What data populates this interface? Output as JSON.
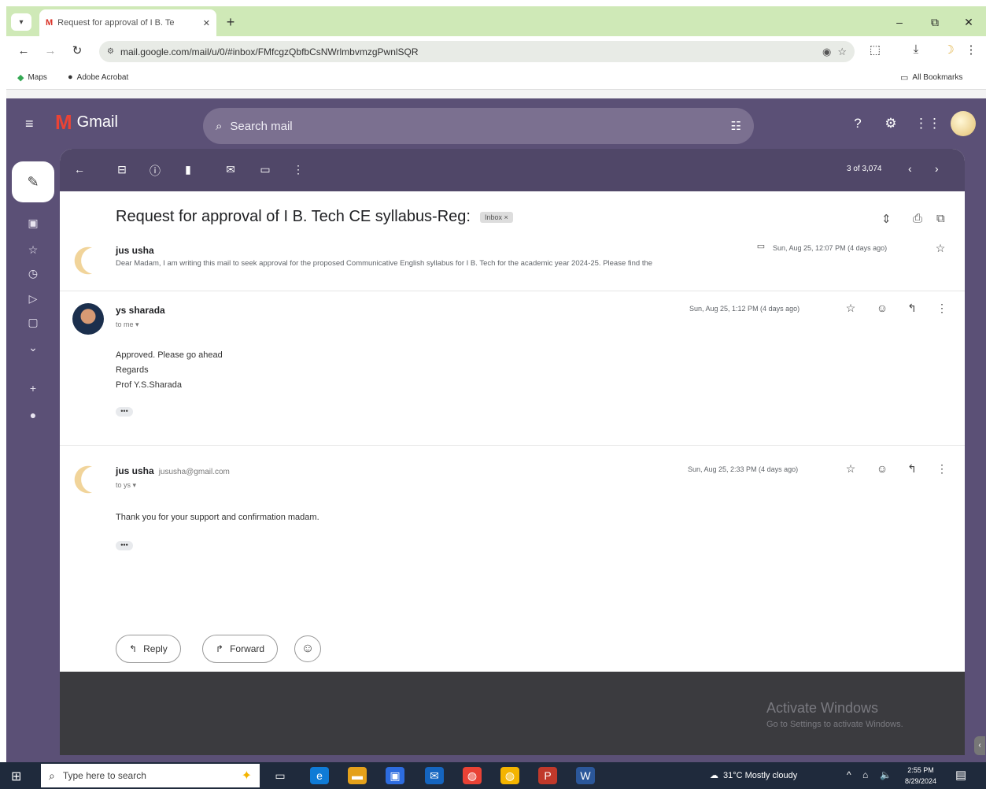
{
  "browser": {
    "tab_title": "Request for approval of I B. Te",
    "tab_favicon": "M",
    "new_tab": "+",
    "window": {
      "minimize": "–",
      "restore": "⧉",
      "close": "✕"
    },
    "url": "mail.google.com/mail/u/0/#inbox/FMfcgzQbfbCsNWrlmbvmzgPwnlSQR",
    "bookmarks": [
      {
        "label": "Maps",
        "icon": "maps-icon"
      },
      {
        "label": "Adobe Acrobat",
        "icon": "acrobat-icon"
      }
    ],
    "all_bookmarks": "All Bookmarks"
  },
  "gmail": {
    "logo_text": "Gmail",
    "search_placeholder": "Search mail",
    "pager": "3 of 3,074",
    "subject": "Request for approval of I B. Tech CE syllabus-Reg:",
    "label_chip": "Inbox ×",
    "messages": [
      {
        "sender": "jus usha",
        "date": "Sun, Aug 25, 12:07 PM (4 days ago)",
        "snippet": "Dear Madam, I am writing this mail to seek approval for the proposed Communicative English syllabus for I B. Tech for the academic year 2024-25. Please find the"
      },
      {
        "sender": "ys sharada",
        "to": "to me ▾",
        "date": "Sun, Aug 25, 1:12 PM (4 days ago)",
        "body": [
          "Approved. Please go ahead",
          "Regards",
          "Prof Y.S.Sharada"
        ],
        "dots": "•••"
      },
      {
        "sender": "jus usha",
        "email": "jususha@gmail.com",
        "to": "to ys ▾",
        "date": "Sun, Aug 25, 2:33 PM (4 days ago)",
        "body": [
          "Thank you for your support and confirmation madam."
        ],
        "dots": "•••"
      }
    ],
    "reply_label": "Reply",
    "forward_label": "Forward",
    "activate_title": "Activate Windows",
    "activate_sub": "Go to Settings to activate Windows."
  },
  "taskbar": {
    "search_placeholder": "Type here to search",
    "weather": "31°C  Mostly cloudy",
    "time": "2:55 PM",
    "date": "8/29/2024"
  },
  "colors": {
    "tabstrip": "#cfe9b7",
    "gmail_bg": "#5b5076",
    "taskbar": "#1f2a3c"
  }
}
